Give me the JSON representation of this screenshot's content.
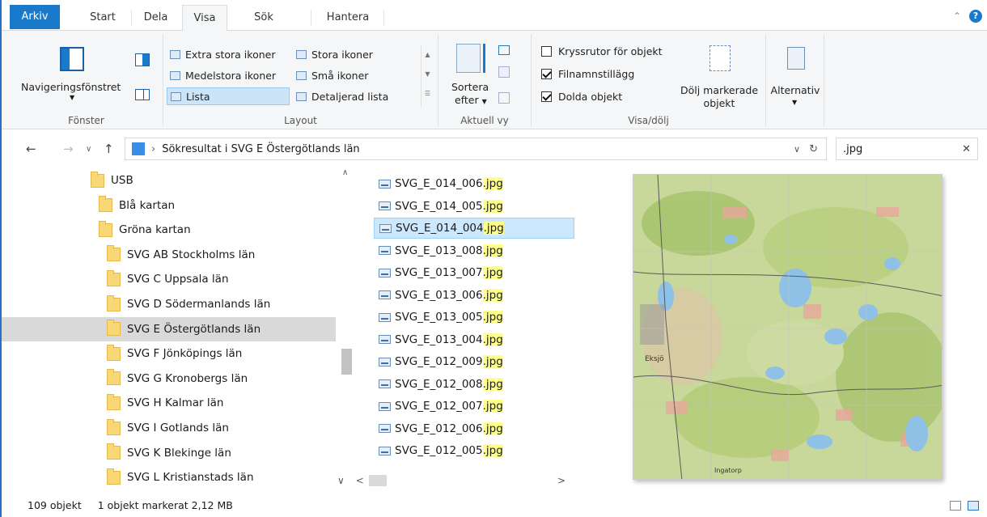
{
  "tabs": [
    "Arkiv",
    "Start",
    "Dela",
    "Visa",
    "Sök",
    "Hantera"
  ],
  "ribbon": {
    "fonster": {
      "nav_pane_label": "Navigeringsfönstret",
      "group_label": "Fönster"
    },
    "layout": {
      "items": [
        {
          "label": "Extra stora ikoner"
        },
        {
          "label": "Stora ikoner"
        },
        {
          "label": "Medelstora ikoner"
        },
        {
          "label": "Små ikoner"
        },
        {
          "label": "Lista"
        },
        {
          "label": "Detaljerad lista"
        }
      ],
      "group_label": "Layout"
    },
    "aktuell_vy": {
      "sort_label_1": "Sortera",
      "sort_label_2": "efter",
      "group_label": "Aktuell vy"
    },
    "visa_dolj": {
      "checkboxes": [
        {
          "label": "Kryssrutor för objekt",
          "checked": false
        },
        {
          "label": "Filnamnstillägg",
          "checked": true
        },
        {
          "label": "Dolda objekt",
          "checked": true
        }
      ],
      "hide_selected_1": "Dölj markerade",
      "hide_selected_2": "objekt",
      "group_label": "Visa/dölj"
    },
    "alternativ": {
      "label": "Alternativ"
    }
  },
  "address": {
    "path": "Sökresultat i SVG E Östergötlands län",
    "separator": "›"
  },
  "search": {
    "value": ".jpg"
  },
  "nav_pane": {
    "items": [
      {
        "label": "USB",
        "indent": 1
      },
      {
        "label": "Blå kartan",
        "indent": 2
      },
      {
        "label": "Gröna kartan",
        "indent": 2
      },
      {
        "label": "SVG AB Stockholms län",
        "indent": 3
      },
      {
        "label": "SVG C Uppsala län",
        "indent": 3
      },
      {
        "label": "SVG D Södermanlands län",
        "indent": 3
      },
      {
        "label": "SVG E Östergötlands län",
        "indent": 3,
        "selected": true
      },
      {
        "label": "SVG F Jönköpings län",
        "indent": 3
      },
      {
        "label": "SVG G Kronobergs län",
        "indent": 3
      },
      {
        "label": "SVG H Kalmar län",
        "indent": 3
      },
      {
        "label": "SVG I Gotlands län",
        "indent": 3
      },
      {
        "label": "SVG K Blekinge län",
        "indent": 3
      },
      {
        "label": "SVG L Kristianstads län",
        "indent": 3
      }
    ]
  },
  "files": [
    {
      "base": "SVG_E_014_006",
      "ext": ".jpg"
    },
    {
      "base": "SVG_E_014_005",
      "ext": ".jpg"
    },
    {
      "base": "SVG_E_014_004",
      "ext": ".jpg",
      "selected": true
    },
    {
      "base": "SVG_E_013_008",
      "ext": ".jpg"
    },
    {
      "base": "SVG_E_013_007",
      "ext": ".jpg"
    },
    {
      "base": "SVG_E_013_006",
      "ext": ".jpg"
    },
    {
      "base": "SVG_E_013_005",
      "ext": ".jpg"
    },
    {
      "base": "SVG_E_013_004",
      "ext": ".jpg"
    },
    {
      "base": "SVG_E_012_009",
      "ext": ".jpg"
    },
    {
      "base": "SVG_E_012_008",
      "ext": ".jpg"
    },
    {
      "base": "SVG_E_012_007",
      "ext": ".jpg"
    },
    {
      "base": "SVG_E_012_006",
      "ext": ".jpg"
    },
    {
      "base": "SVG_E_012_005",
      "ext": ".jpg"
    }
  ],
  "preview": {
    "place_label_1": "Eksjö",
    "place_label_2": "Ingatorp"
  },
  "status": {
    "count": "109 objekt",
    "selection": "1 objekt markerat  2,12 MB"
  },
  "colors": {
    "accent": "#1979ca",
    "selection": "#cce8ff",
    "highlight": "#ffff8c"
  }
}
